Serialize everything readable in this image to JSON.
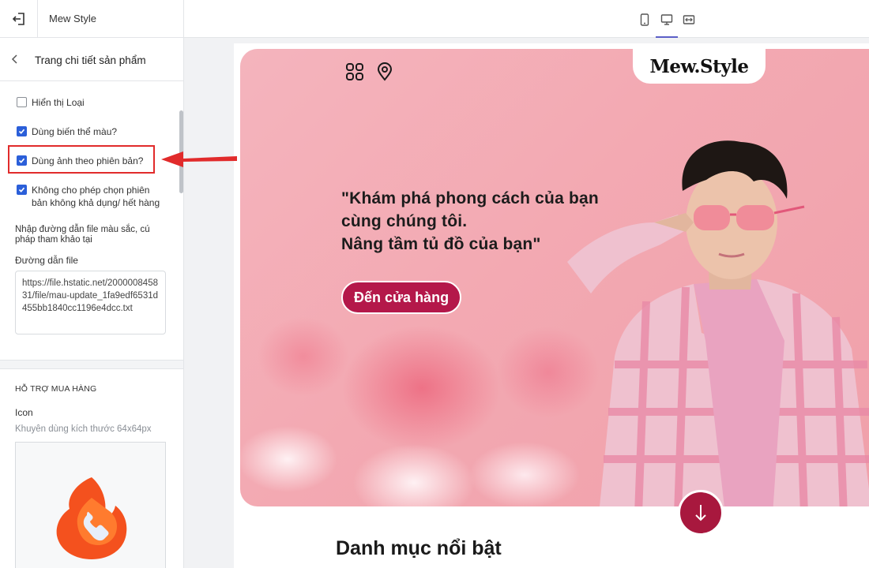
{
  "topbar": {
    "app_title": "Mew Style",
    "view_modes": [
      {
        "name": "mobile",
        "icon": "mobile-icon",
        "active": false
      },
      {
        "name": "desktop",
        "icon": "desktop-icon",
        "active": true
      },
      {
        "name": "fullwidth",
        "icon": "fullwidth-icon",
        "active": false
      }
    ]
  },
  "sidebar": {
    "title": "Trang chi tiết sản phẩm",
    "options": [
      {
        "label": "Hiển thị Loại",
        "checked": false
      },
      {
        "label": "Dùng biến thể màu?",
        "checked": true
      },
      {
        "label": "Dùng ảnh theo phiên bản?",
        "checked": true,
        "highlighted": true
      },
      {
        "label": "Không cho phép chọn phiên bản không khả dụng/ hết hàng",
        "checked": true
      }
    ],
    "file_help": "Nhập đường dẫn file màu sắc, cú pháp tham khảo tại",
    "file_label": "Đường dẫn file",
    "file_value": "https://file.hstatic.net/200000845831/file/mau-update_1fa9edf6531d455bb1840cc1196e4dcc.txt",
    "support_section": {
      "title": "HỖ TRỢ MUA HÀNG",
      "icon_label": "Icon",
      "icon_hint": "Khuyên dùng kích thước 64x64px"
    }
  },
  "preview": {
    "logo": "Mew.Style",
    "hero_lines": [
      "\"Khám phá phong cách của bạn",
      "cùng chúng tôi.",
      "Nâng tầm tủ đồ của bạn\""
    ],
    "cta_label": "Đến cửa hàng",
    "section_heading": "Danh mục nổi bật"
  },
  "colors": {
    "accent": "#b4184a",
    "checkbox": "#2b5fd9",
    "annotation": "#e12b2b",
    "hero_bg": "#f3a9b2"
  }
}
